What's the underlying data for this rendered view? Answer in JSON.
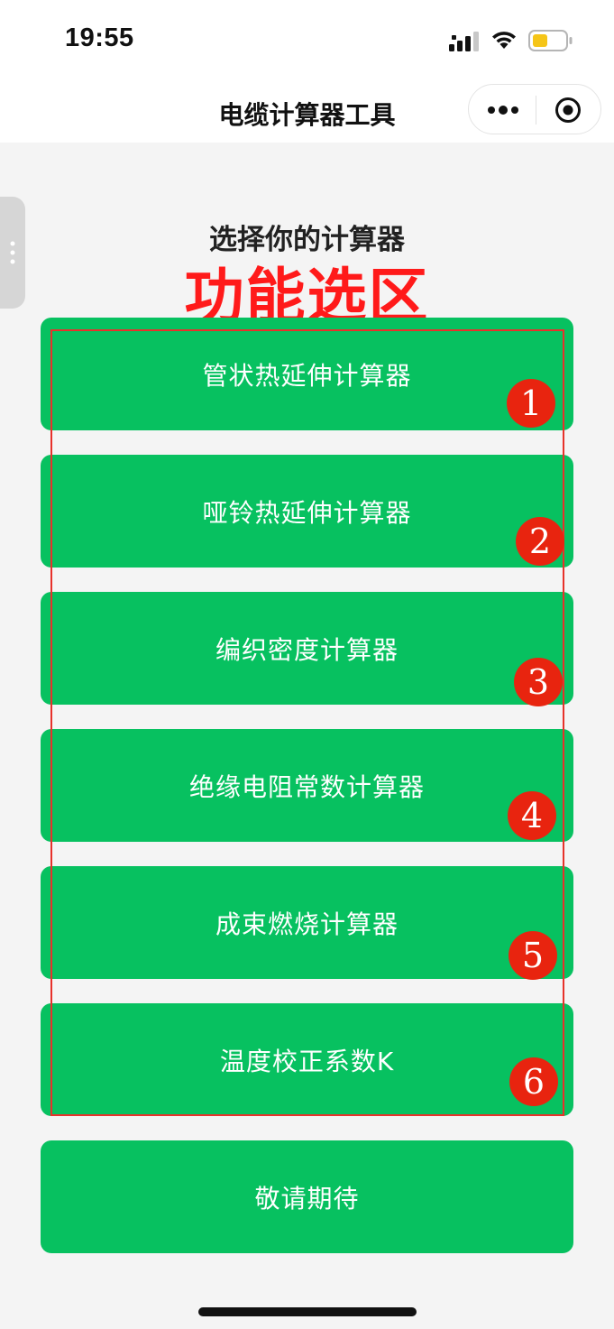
{
  "status_bar": {
    "time": "19:55",
    "icons": [
      "signal-icon",
      "wifi-icon",
      "battery-icon"
    ],
    "battery_color": "#f5c518"
  },
  "nav_bar": {
    "title": "电缆计算器工具",
    "icons": [
      "more-icon",
      "close-mini-program-icon"
    ]
  },
  "main": {
    "heading": "选择你的计算器",
    "overlay_title": "功能选区",
    "buttons": [
      {
        "label": "管状热延伸计算器",
        "badge": "1"
      },
      {
        "label": "哑铃热延伸计算器",
        "badge": "2"
      },
      {
        "label": "编织密度计算器",
        "badge": "3"
      },
      {
        "label": "绝缘电阻常数计算器",
        "badge": "4"
      },
      {
        "label": "成束燃烧计算器",
        "badge": "5"
      },
      {
        "label": "温度校正系数K",
        "badge": "6"
      },
      {
        "label": "敬请期待"
      }
    ]
  },
  "colors": {
    "button_green": "#07c160",
    "annotation_red": "#e8240f",
    "background": "#f4f4f4"
  }
}
